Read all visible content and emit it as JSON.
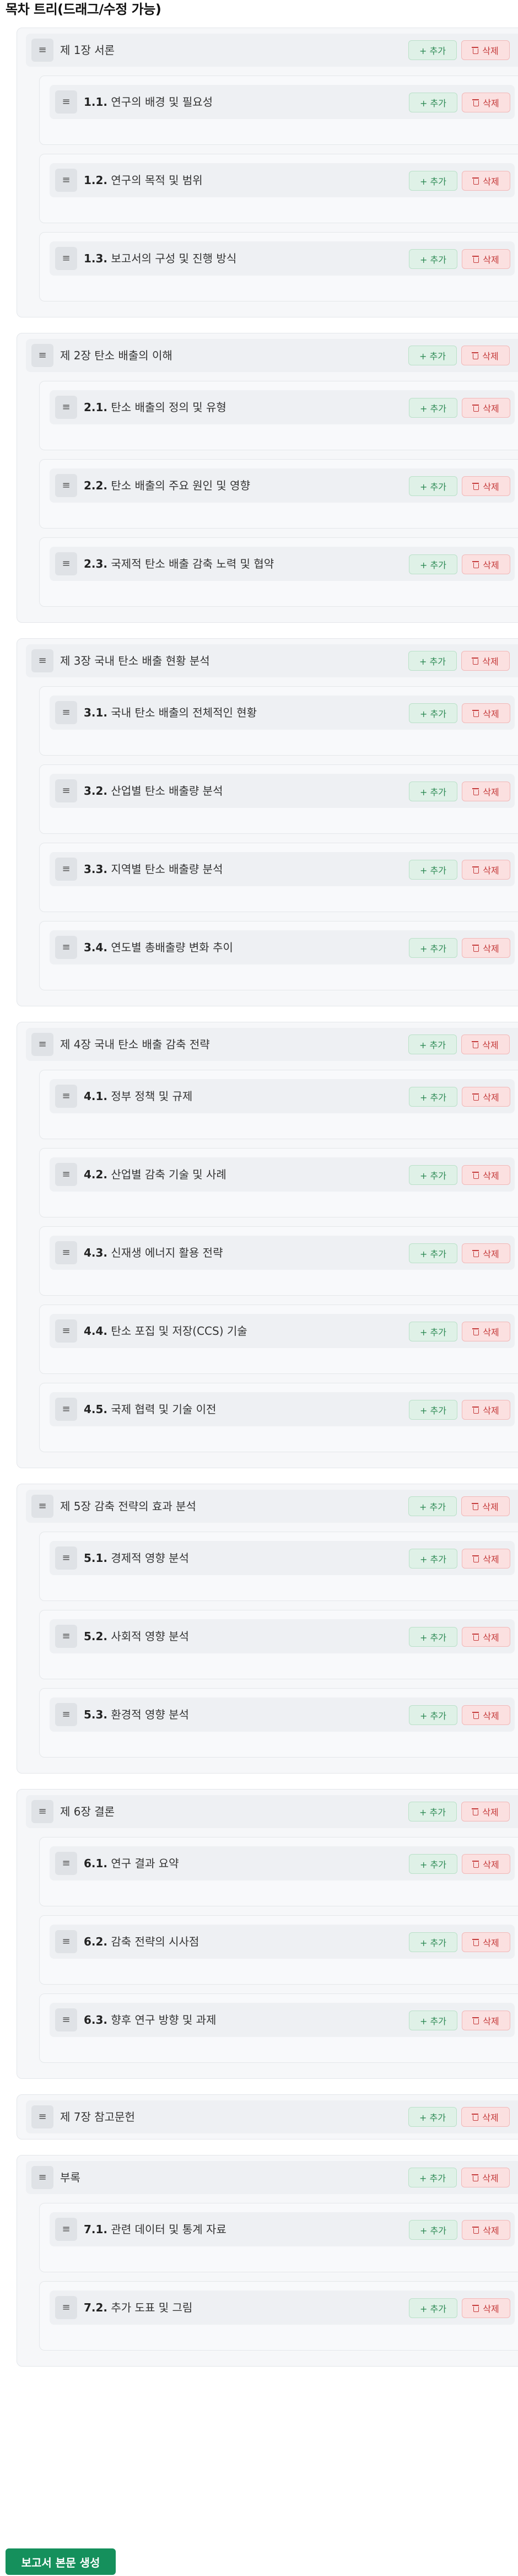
{
  "page_title": "목차 트리(드래그/수정 가능)",
  "buttons": {
    "add_label": "+ 추가",
    "delete_label": "삭제",
    "generate_label": "보고서 본문 생성"
  },
  "icons": {
    "drag_handle": "drag-handle-icon",
    "delete": "trash-icon"
  },
  "colors": {
    "add": "#2e8a55",
    "delete": "#c53b3b",
    "generate": "#15905c"
  },
  "chapters": [
    {
      "title": "제 1장 서론",
      "items": [
        {
          "num": "1.1.",
          "title": "연구의 배경 및 필요성"
        },
        {
          "num": "1.2.",
          "title": "연구의 목적 및 범위"
        },
        {
          "num": "1.3.",
          "title": "보고서의 구성 및 진행 방식"
        }
      ]
    },
    {
      "title": "제 2장 탄소 배출의 이해",
      "items": [
        {
          "num": "2.1.",
          "title": "탄소 배출의 정의 및 유형"
        },
        {
          "num": "2.2.",
          "title": "탄소 배출의 주요 원인 및 영향"
        },
        {
          "num": "2.3.",
          "title": "국제적 탄소 배출 감축 노력 및 협약"
        }
      ]
    },
    {
      "title": "제 3장 국내 탄소 배출 현황 분석",
      "items": [
        {
          "num": "3.1.",
          "title": "국내 탄소 배출의 전체적인 현황"
        },
        {
          "num": "3.2.",
          "title": "산업별 탄소 배출량 분석"
        },
        {
          "num": "3.3.",
          "title": "지역별 탄소 배출량 분석"
        },
        {
          "num": "3.4.",
          "title": "연도별 총배출량 변화 추이"
        }
      ]
    },
    {
      "title": "제 4장 국내 탄소 배출 감축 전략",
      "items": [
        {
          "num": "4.1.",
          "title": "정부 정책 및 규제"
        },
        {
          "num": "4.2.",
          "title": "산업별 감축 기술 및 사례"
        },
        {
          "num": "4.3.",
          "title": "신재생 에너지 활용 전략"
        },
        {
          "num": "4.4.",
          "title": "탄소 포집 및 저장(CCS) 기술"
        },
        {
          "num": "4.5.",
          "title": "국제 협력 및 기술 이전"
        }
      ]
    },
    {
      "title": "제 5장 감축 전략의 효과 분석",
      "items": [
        {
          "num": "5.1.",
          "title": "경제적 영향 분석"
        },
        {
          "num": "5.2.",
          "title": "사회적 영향 분석"
        },
        {
          "num": "5.3.",
          "title": "환경적 영향 분석"
        }
      ]
    },
    {
      "title": "제 6장 결론",
      "items": [
        {
          "num": "6.1.",
          "title": "연구 결과 요약"
        },
        {
          "num": "6.2.",
          "title": "감축 전략의 시사점"
        },
        {
          "num": "6.3.",
          "title": "향후 연구 방향 및 과제"
        }
      ]
    },
    {
      "title": "제 7장 참고문헌",
      "items": []
    },
    {
      "title": "부록",
      "items": [
        {
          "num": "7.1.",
          "title": "관련 데이터 및 통계 자료"
        },
        {
          "num": "7.2.",
          "title": "추가 도표 및 그림"
        }
      ]
    }
  ]
}
